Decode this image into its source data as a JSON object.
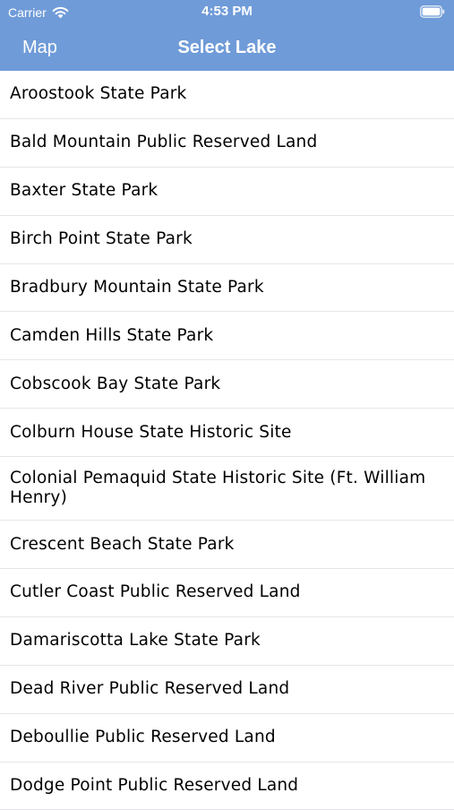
{
  "status_bar": {
    "carrier": "Carrier",
    "time": "4:53 PM",
    "icons": [
      "wifi-icon",
      "battery-icon"
    ]
  },
  "nav_bar": {
    "back_label": "Map",
    "title": "Select Lake",
    "background_color": "#6f9bd8"
  },
  "list": {
    "items": [
      "Aroostook State Park",
      "Bald Mountain Public Reserved Land",
      "Baxter State Park",
      "Birch Point State Park",
      "Bradbury Mountain State Park",
      "Camden Hills State Park",
      "Cobscook Bay State Park",
      "Colburn House State Historic Site",
      "Colonial Pemaquid State Historic Site (Ft. William Henry)",
      "Crescent Beach State Park",
      "Cutler Coast Public Reserved Land",
      "Damariscotta Lake State Park",
      "Dead River Public Reserved Land",
      "Deboullie Public Reserved Land",
      "Dodge Point Public Reserved Land"
    ]
  }
}
